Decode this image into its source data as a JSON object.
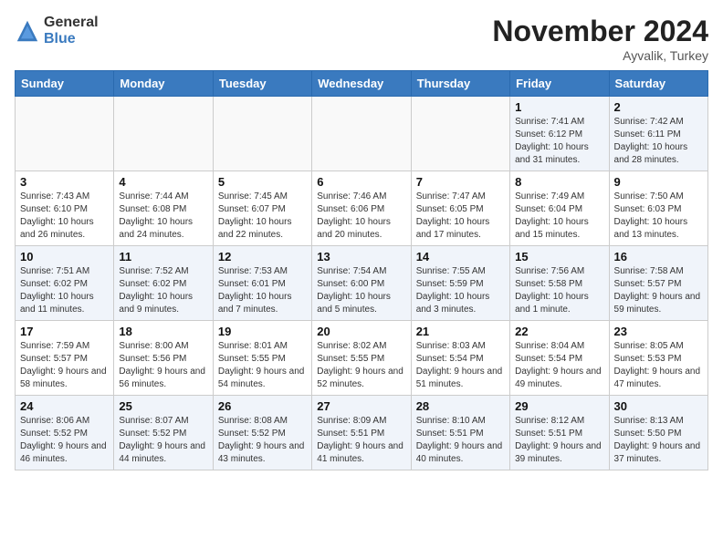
{
  "header": {
    "logo_general": "General",
    "logo_blue": "Blue",
    "month": "November 2024",
    "location": "Ayvalik, Turkey"
  },
  "weekdays": [
    "Sunday",
    "Monday",
    "Tuesday",
    "Wednesday",
    "Thursday",
    "Friday",
    "Saturday"
  ],
  "weeks": [
    [
      {
        "day": "",
        "info": ""
      },
      {
        "day": "",
        "info": ""
      },
      {
        "day": "",
        "info": ""
      },
      {
        "day": "",
        "info": ""
      },
      {
        "day": "",
        "info": ""
      },
      {
        "day": "1",
        "info": "Sunrise: 7:41 AM\nSunset: 6:12 PM\nDaylight: 10 hours and 31 minutes."
      },
      {
        "day": "2",
        "info": "Sunrise: 7:42 AM\nSunset: 6:11 PM\nDaylight: 10 hours and 28 minutes."
      }
    ],
    [
      {
        "day": "3",
        "info": "Sunrise: 7:43 AM\nSunset: 6:10 PM\nDaylight: 10 hours and 26 minutes."
      },
      {
        "day": "4",
        "info": "Sunrise: 7:44 AM\nSunset: 6:08 PM\nDaylight: 10 hours and 24 minutes."
      },
      {
        "day": "5",
        "info": "Sunrise: 7:45 AM\nSunset: 6:07 PM\nDaylight: 10 hours and 22 minutes."
      },
      {
        "day": "6",
        "info": "Sunrise: 7:46 AM\nSunset: 6:06 PM\nDaylight: 10 hours and 20 minutes."
      },
      {
        "day": "7",
        "info": "Sunrise: 7:47 AM\nSunset: 6:05 PM\nDaylight: 10 hours and 17 minutes."
      },
      {
        "day": "8",
        "info": "Sunrise: 7:49 AM\nSunset: 6:04 PM\nDaylight: 10 hours and 15 minutes."
      },
      {
        "day": "9",
        "info": "Sunrise: 7:50 AM\nSunset: 6:03 PM\nDaylight: 10 hours and 13 minutes."
      }
    ],
    [
      {
        "day": "10",
        "info": "Sunrise: 7:51 AM\nSunset: 6:02 PM\nDaylight: 10 hours and 11 minutes."
      },
      {
        "day": "11",
        "info": "Sunrise: 7:52 AM\nSunset: 6:02 PM\nDaylight: 10 hours and 9 minutes."
      },
      {
        "day": "12",
        "info": "Sunrise: 7:53 AM\nSunset: 6:01 PM\nDaylight: 10 hours and 7 minutes."
      },
      {
        "day": "13",
        "info": "Sunrise: 7:54 AM\nSunset: 6:00 PM\nDaylight: 10 hours and 5 minutes."
      },
      {
        "day": "14",
        "info": "Sunrise: 7:55 AM\nSunset: 5:59 PM\nDaylight: 10 hours and 3 minutes."
      },
      {
        "day": "15",
        "info": "Sunrise: 7:56 AM\nSunset: 5:58 PM\nDaylight: 10 hours and 1 minute."
      },
      {
        "day": "16",
        "info": "Sunrise: 7:58 AM\nSunset: 5:57 PM\nDaylight: 9 hours and 59 minutes."
      }
    ],
    [
      {
        "day": "17",
        "info": "Sunrise: 7:59 AM\nSunset: 5:57 PM\nDaylight: 9 hours and 58 minutes."
      },
      {
        "day": "18",
        "info": "Sunrise: 8:00 AM\nSunset: 5:56 PM\nDaylight: 9 hours and 56 minutes."
      },
      {
        "day": "19",
        "info": "Sunrise: 8:01 AM\nSunset: 5:55 PM\nDaylight: 9 hours and 54 minutes."
      },
      {
        "day": "20",
        "info": "Sunrise: 8:02 AM\nSunset: 5:55 PM\nDaylight: 9 hours and 52 minutes."
      },
      {
        "day": "21",
        "info": "Sunrise: 8:03 AM\nSunset: 5:54 PM\nDaylight: 9 hours and 51 minutes."
      },
      {
        "day": "22",
        "info": "Sunrise: 8:04 AM\nSunset: 5:54 PM\nDaylight: 9 hours and 49 minutes."
      },
      {
        "day": "23",
        "info": "Sunrise: 8:05 AM\nSunset: 5:53 PM\nDaylight: 9 hours and 47 minutes."
      }
    ],
    [
      {
        "day": "24",
        "info": "Sunrise: 8:06 AM\nSunset: 5:52 PM\nDaylight: 9 hours and 46 minutes."
      },
      {
        "day": "25",
        "info": "Sunrise: 8:07 AM\nSunset: 5:52 PM\nDaylight: 9 hours and 44 minutes."
      },
      {
        "day": "26",
        "info": "Sunrise: 8:08 AM\nSunset: 5:52 PM\nDaylight: 9 hours and 43 minutes."
      },
      {
        "day": "27",
        "info": "Sunrise: 8:09 AM\nSunset: 5:51 PM\nDaylight: 9 hours and 41 minutes."
      },
      {
        "day": "28",
        "info": "Sunrise: 8:10 AM\nSunset: 5:51 PM\nDaylight: 9 hours and 40 minutes."
      },
      {
        "day": "29",
        "info": "Sunrise: 8:12 AM\nSunset: 5:51 PM\nDaylight: 9 hours and 39 minutes."
      },
      {
        "day": "30",
        "info": "Sunrise: 8:13 AM\nSunset: 5:50 PM\nDaylight: 9 hours and 37 minutes."
      }
    ]
  ]
}
